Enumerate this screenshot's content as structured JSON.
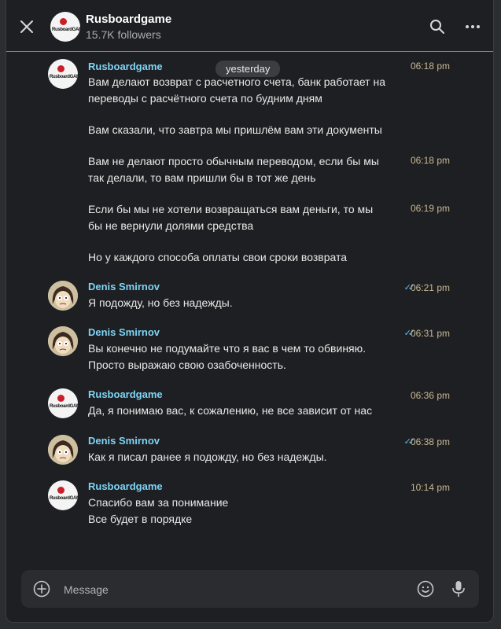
{
  "header": {
    "title": "Rusboardgame",
    "followers": "15.7K followers",
    "logo_text": "RusboardGAME"
  },
  "date_separator": "yesterday",
  "messages": [
    {
      "sender": "Rusboardgame",
      "avatar": "rusboardgame-logo",
      "time": "06:18 pm",
      "lines": [
        "Вам делают возврат с расчетного счета, банк работает на",
        "переводы с расчётного счета по будним дням"
      ]
    },
    {
      "lines": [
        "Вам сказали, что завтра мы пришлём вам эти документы"
      ]
    },
    {
      "time": "06:18 pm",
      "lines": [
        "Вам не делают просто обычным переводом, если бы мы",
        "так делали, то вам пришли бы в тот же день"
      ]
    },
    {
      "time": "06:19 pm",
      "lines": [
        "Если бы мы не хотели возвращаться вам деньги, то мы",
        "бы не вернули долями средства"
      ]
    },
    {
      "lines": [
        "Но у каждого способа оплаты свои сроки возврата"
      ]
    },
    {
      "sender": "Denis Smirnov",
      "avatar": "user-photo",
      "time": "06:21 pm",
      "read": true,
      "lines": [
        "Я подожду, но без надежды."
      ]
    },
    {
      "sender": "Denis Smirnov",
      "avatar": "user-photo",
      "time": "06:31 pm",
      "read": true,
      "lines": [
        "Вы конечно не подумайте что я вас в чем то обвиняю.",
        "Просто выражаю свою озабоченность."
      ]
    },
    {
      "sender": "Rusboardgame",
      "avatar": "rusboardgame-logo",
      "time": "06:36 pm",
      "lines": [
        "Да, я понимаю вас, к сожалению, не все зависит от нас"
      ]
    },
    {
      "sender": "Denis Smirnov",
      "avatar": "user-photo",
      "time": "06:38 pm",
      "read": true,
      "lines": [
        "Как я писал ранее я подожду, но без надежды."
      ]
    },
    {
      "sender": "Rusboardgame",
      "avatar": "rusboardgame-logo",
      "time": "10:14 pm",
      "lines": [
        "Спасибо вам за понимание",
        "Все будет в порядке"
      ]
    }
  ],
  "composer": {
    "placeholder": "Message"
  },
  "colors": {
    "background": "#1e1f22",
    "sender_name": "#7fd4f5",
    "timestamp": "#c9b894",
    "read_check": "#6ab7e8"
  }
}
